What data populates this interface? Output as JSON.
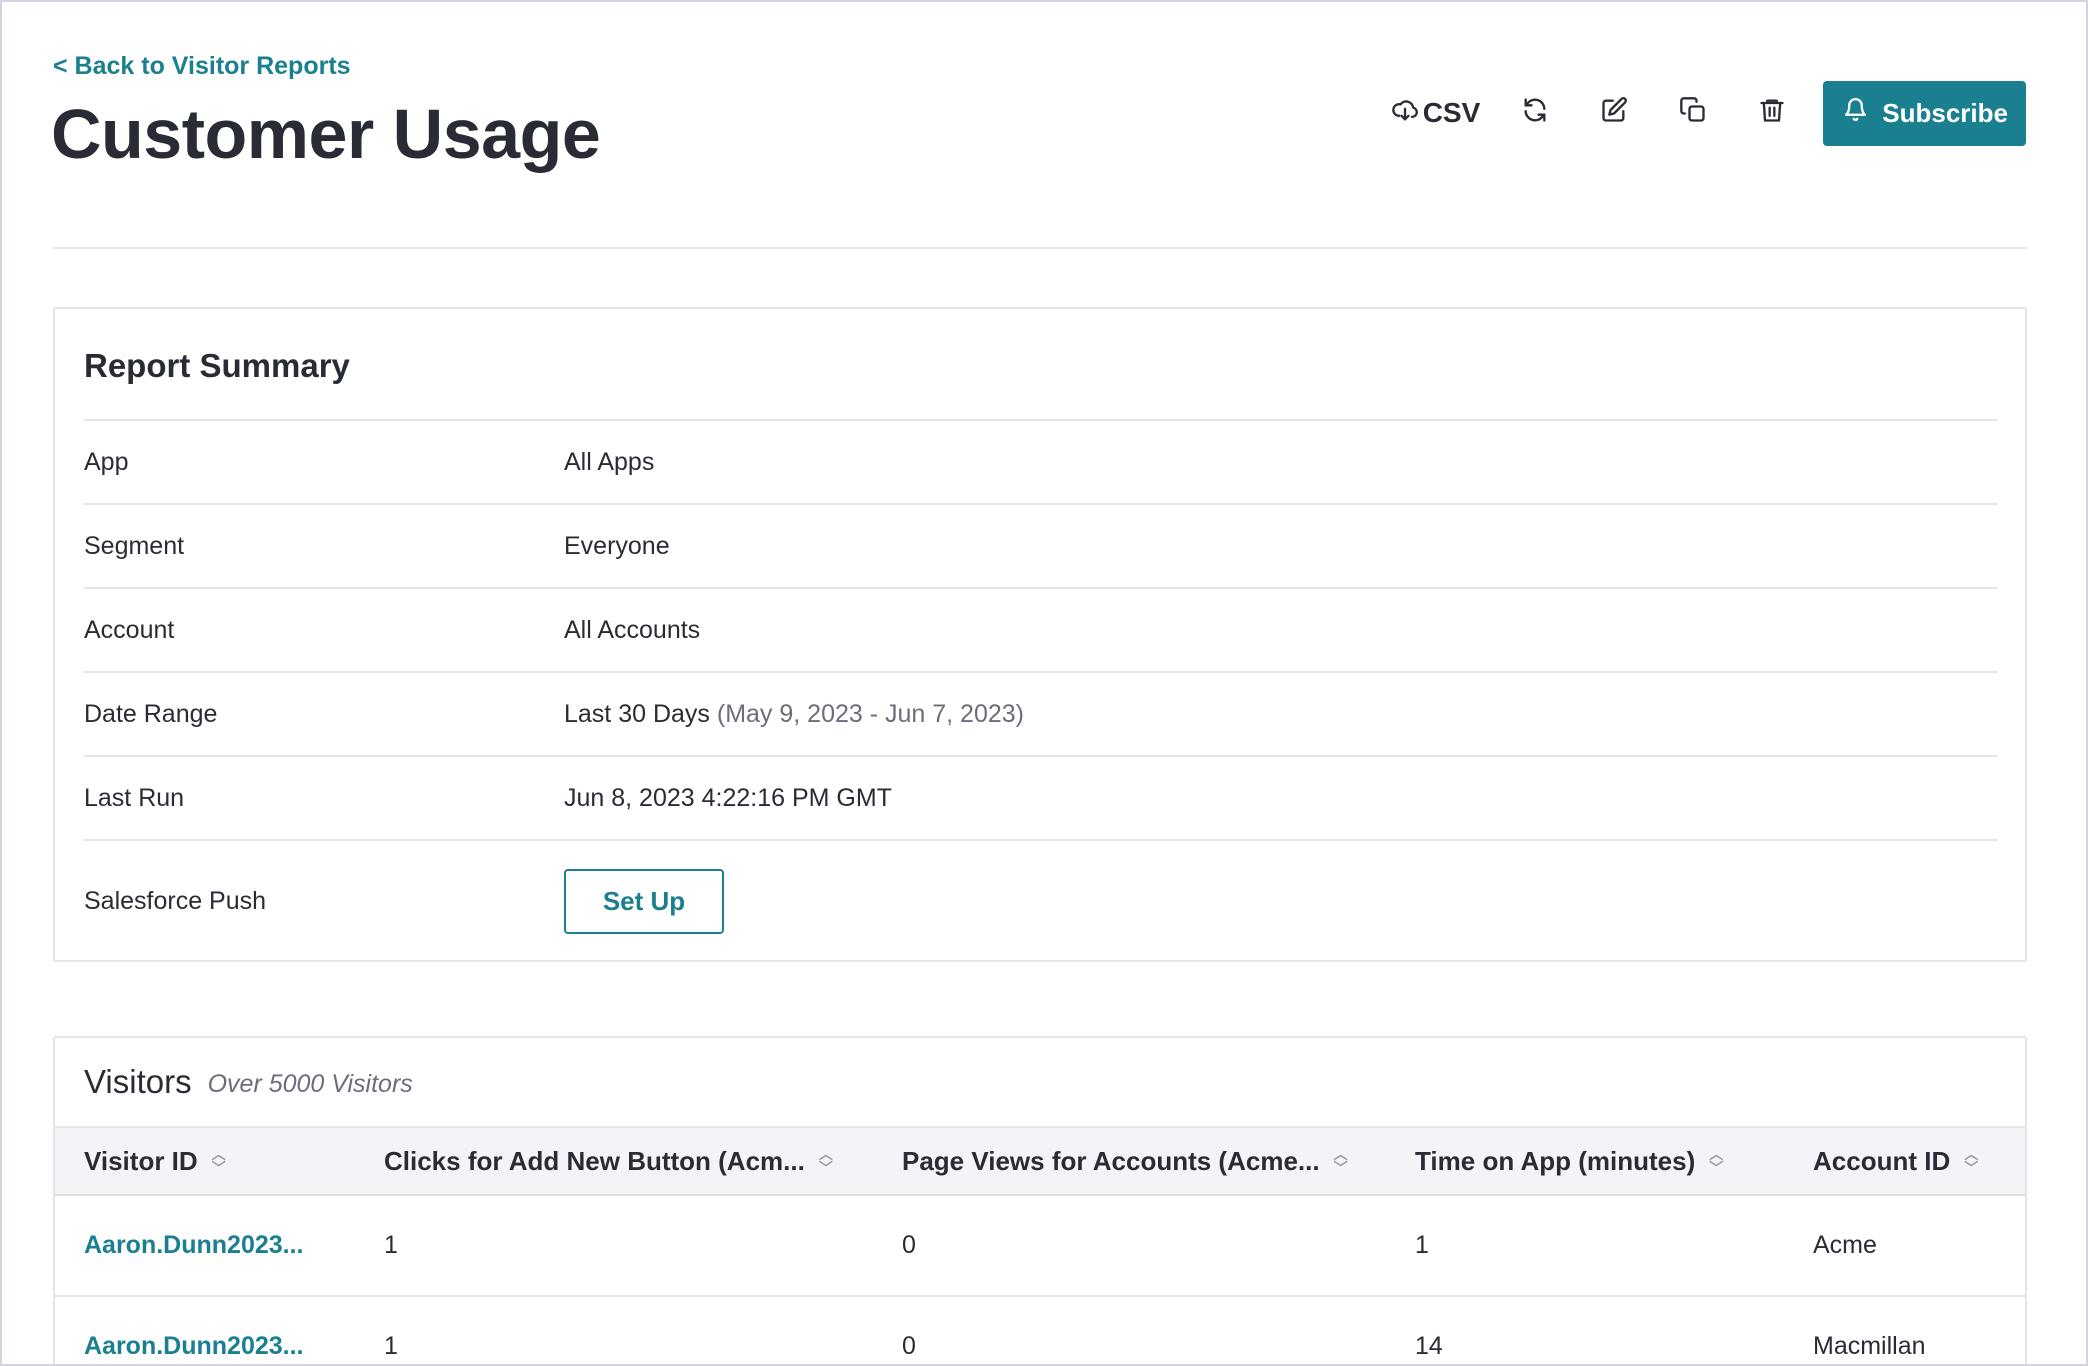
{
  "header": {
    "back_link": "< Back to Visitor Reports",
    "title": "Customer Usage"
  },
  "toolbar": {
    "csv_label": "CSV",
    "subscribe_label": "Subscribe",
    "icons": [
      "cloud-download-icon",
      "refresh-icon",
      "edit-icon",
      "copy-icon",
      "trash-icon",
      "bell-icon"
    ]
  },
  "summary": {
    "title": "Report Summary",
    "rows": [
      {
        "label": "App",
        "value": "All Apps"
      },
      {
        "label": "Segment",
        "value": "Everyone"
      },
      {
        "label": "Account",
        "value": "All Accounts"
      },
      {
        "label": "Date Range",
        "value": "Last 30 Days",
        "detail": "(May 9, 2023 - Jun 7, 2023)"
      },
      {
        "label": "Last Run",
        "value": "Jun 8, 2023 4:22:16 PM GMT"
      },
      {
        "label": "Salesforce Push",
        "button": "Set Up"
      }
    ]
  },
  "visitors": {
    "title": "Visitors",
    "count": "Over 5000 Visitors",
    "columns": [
      "Visitor ID",
      "Clicks for Add New Button (Acm...",
      "Page Views for Accounts (Acme...",
      "Time on App (minutes)",
      "Account ID"
    ],
    "rows": [
      [
        "Aaron.Dunn2023...",
        "1",
        "0",
        "1",
        "Acme"
      ],
      [
        "Aaron.Dunn2023...",
        "1",
        "0",
        "14",
        "Macmillan"
      ]
    ]
  },
  "colors": {
    "accent": "#1a7f8e",
    "text": "#2a2c35",
    "border": "#e4e4ea"
  }
}
